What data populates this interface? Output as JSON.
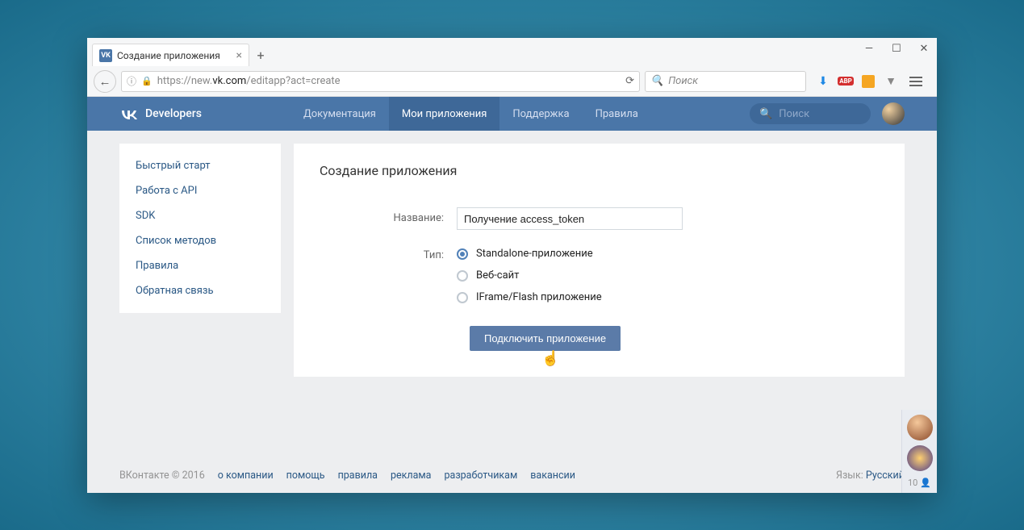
{
  "browser": {
    "tab_title": "Создание приложения",
    "url_proto": "https://",
    "url_prefix": "new.",
    "url_domain": "vk.com",
    "url_path": "/editapp?act=create",
    "search_placeholder": "Поиск",
    "abp_label": "ABP"
  },
  "header": {
    "logo_text": "Developers",
    "nav": [
      "Документация",
      "Мои приложения",
      "Поддержка",
      "Правила"
    ],
    "active_nav_index": 1,
    "search_placeholder": "Поиск"
  },
  "sidebar": {
    "items": [
      "Быстрый старт",
      "Работа с API",
      "SDK",
      "Список методов",
      "Правила",
      "Обратная связь"
    ]
  },
  "panel": {
    "title": "Создание приложения",
    "name_label": "Название:",
    "name_value": "Получение access_token",
    "type_label": "Тип:",
    "types": [
      "Standalone-приложение",
      "Веб-сайт",
      "IFrame/Flash приложение"
    ],
    "selected_type_index": 0,
    "submit_label": "Подключить приложение"
  },
  "footer": {
    "copyright": "ВКонтакте © 2016",
    "links": [
      "о компании",
      "помощь",
      "правила",
      "реклама",
      "разработчикам",
      "вакансии"
    ],
    "lang_label": "Язык:",
    "lang_value": "Русский"
  },
  "friends": {
    "online_count": "10"
  }
}
